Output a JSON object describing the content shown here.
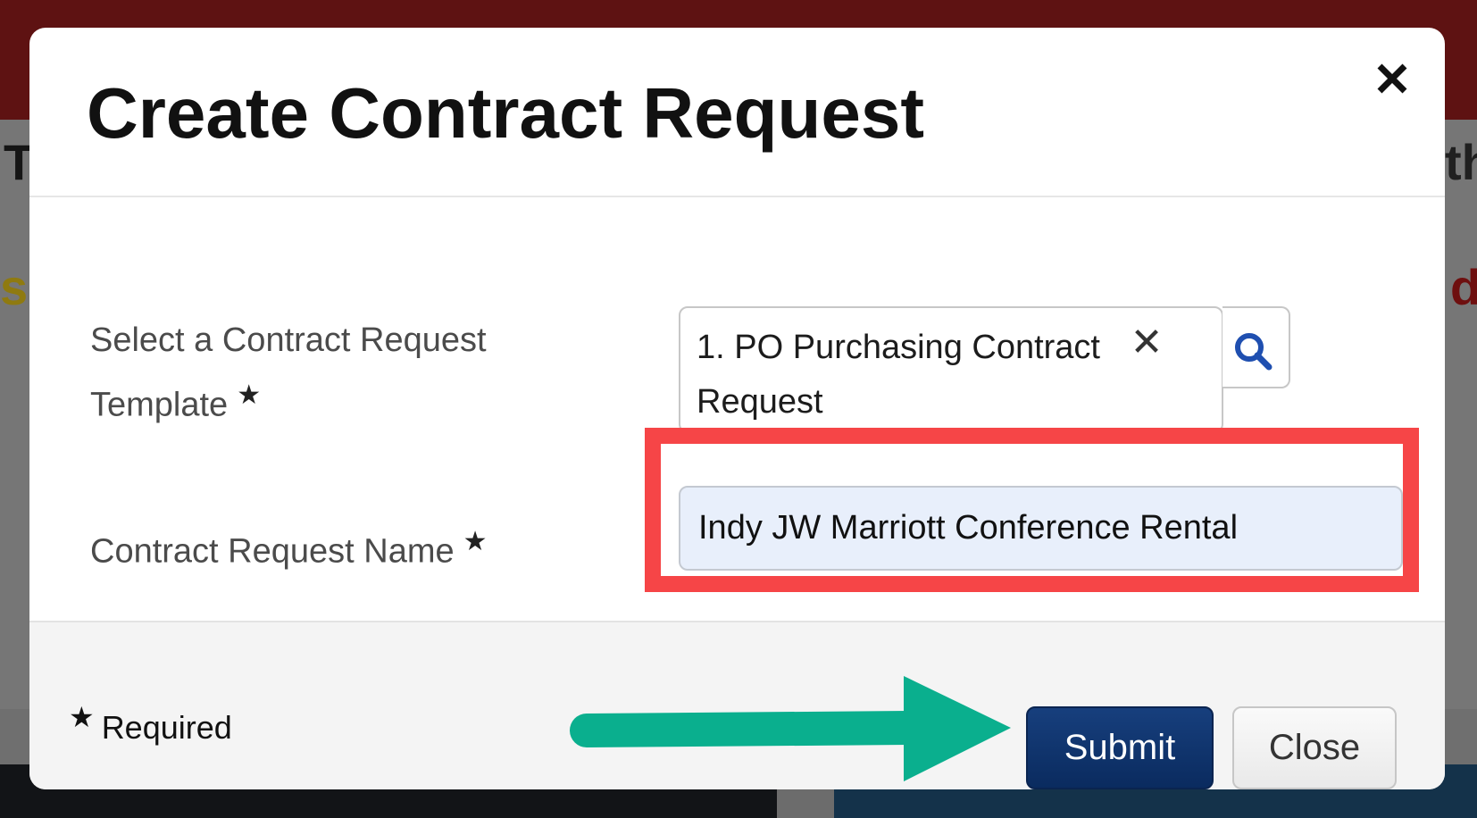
{
  "background": {
    "left_fragment_top": "T",
    "left_fragment_mid": "s",
    "right_fragment_top": "th",
    "right_fragment_mid": "d"
  },
  "modal": {
    "title": "Create Contract Request",
    "close_icon": "close-icon",
    "template_field": {
      "label": "Select a Contract Request Template",
      "required_mark": "★",
      "value": "1. PO Purchasing Contract Request",
      "clear_glyph": "✕",
      "search_icon": "search-icon"
    },
    "name_field": {
      "label": "Contract Request Name",
      "required_mark": "★",
      "value": "Indy JW Marriott Conference Rental"
    },
    "footer": {
      "required_mark": "★",
      "required_note": "Required",
      "submit_label": "Submit",
      "close_label": "Close"
    }
  },
  "annotations": {
    "highlight_color": "#f64547",
    "arrow_color": "#0aaf8e"
  },
  "colors": {
    "submit_bg": "#0d3069",
    "top_bar": "#5e1212"
  }
}
